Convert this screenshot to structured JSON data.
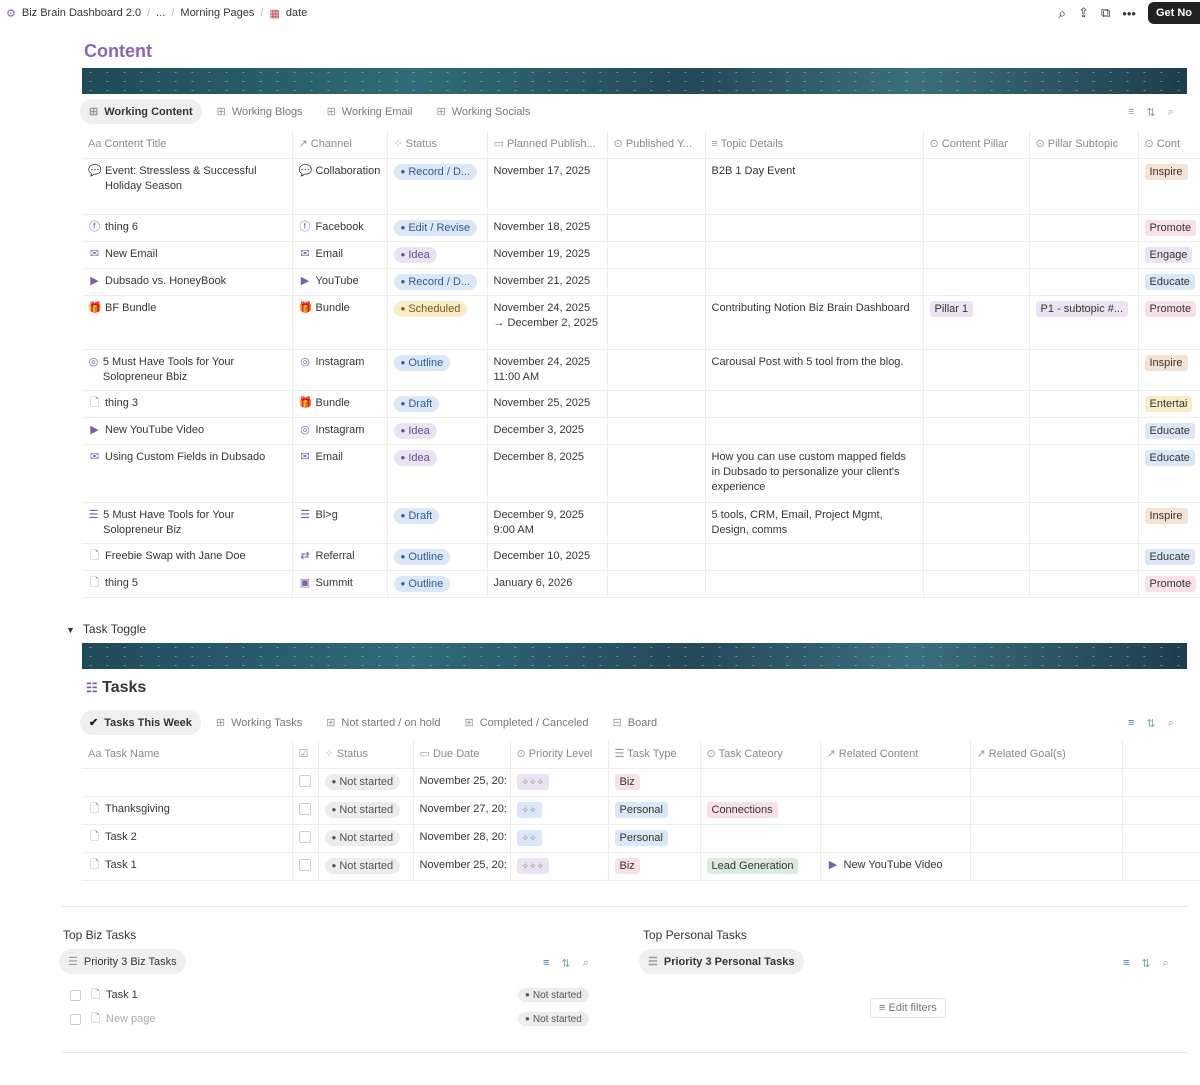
{
  "breadcrumb": {
    "workspace": "Biz Brain Dashboard 2.0",
    "ellipsis": "...",
    "parent": "Morning Pages",
    "page": "date"
  },
  "topbar": {
    "get_button": "Get No"
  },
  "content": {
    "title": "Content",
    "tabs": [
      "Working Content",
      "Working Blogs",
      "Working Email",
      "Working Socials"
    ],
    "columns": [
      "Content Title",
      "Channel",
      "Status",
      "Planned Publish...",
      "Published Y...",
      "Topic Details",
      "Content Pillar",
      "Pillar Subtopic",
      "Cont"
    ],
    "rows": [
      {
        "title": "Event: Stressless & Successful Holiday Season",
        "icon": "💬",
        "channel": "Collaboration",
        "channel_icon": "💬",
        "status": "Record / D...",
        "status_color": "blue",
        "planned": "November 17, 2025",
        "topic": "B2B 1 Day Event",
        "pillar": "",
        "subtopic": "",
        "cont": "Inspire",
        "cont_color": "orange"
      },
      {
        "title": "thing 6",
        "icon": "ⓕ",
        "channel": "Facebook",
        "channel_icon": "ⓕ",
        "status": "Edit / Revise",
        "status_color": "blue",
        "planned": "November 18, 2025",
        "topic": "",
        "pillar": "",
        "subtopic": "",
        "cont": "Promote",
        "cont_color": "red"
      },
      {
        "title": "New Email",
        "icon": "✉",
        "channel": "Email",
        "channel_icon": "✉",
        "status": "Idea",
        "status_color": "purple",
        "planned": "November 19, 2025",
        "topic": "",
        "pillar": "",
        "subtopic": "",
        "cont": "Engage",
        "cont_color": "purple"
      },
      {
        "title": "Dubsado vs. HoneyBook",
        "icon": "▶",
        "channel": "YouTube",
        "channel_icon": "▶",
        "status": "Record / D...",
        "status_color": "blue",
        "planned": "November 21, 2025",
        "topic": "",
        "pillar": "",
        "subtopic": "",
        "cont": "Educate",
        "cont_color": "blue"
      },
      {
        "title": "BF Bundle",
        "icon": "🎁",
        "channel": "Bundle",
        "channel_icon": "🎁",
        "status": "Scheduled",
        "status_color": "yellow",
        "planned": "November 24, 2025 → December 2, 2025",
        "topic": "Contributing Notion Biz Brain Dashboard",
        "pillar": "Pillar 1",
        "subtopic": "P1 - subtopic #...",
        "cont": "Promote",
        "cont_color": "red"
      },
      {
        "title": "5 Must Have Tools for Your Solopreneur Bbiz",
        "icon": "◎",
        "channel": "Instagram",
        "channel_icon": "◎",
        "status": "Outline",
        "status_color": "blue",
        "planned": "November 24, 2025 11:00 AM",
        "topic": "Carousal Post with 5 tool from the blog.",
        "pillar": "",
        "subtopic": "",
        "cont": "Inspire",
        "cont_color": "orange"
      },
      {
        "title": "thing 3",
        "icon": "doc",
        "channel": "Bundle",
        "channel_icon": "🎁",
        "status": "Draft",
        "status_color": "blue",
        "planned": "November 25, 2025",
        "topic": "",
        "pillar": "",
        "subtopic": "",
        "cont": "Entertai",
        "cont_color": "yellow"
      },
      {
        "title": "New YouTube Video",
        "icon": "▶",
        "channel": "Instagram",
        "channel_icon": "◎",
        "status": "Idea",
        "status_color": "purple",
        "planned": "December 3, 2025",
        "topic": "",
        "pillar": "",
        "subtopic": "",
        "cont": "Educate",
        "cont_color": "blue"
      },
      {
        "title": "Using Custom Fields in Dubsado",
        "icon": "✉",
        "channel": "Email",
        "channel_icon": "✉",
        "status": "Idea",
        "status_color": "purple",
        "planned": "December 8, 2025",
        "topic": "How you can use custom mapped fields in Dubsado to personalize your client's experience",
        "pillar": "",
        "subtopic": "",
        "cont": "Educate",
        "cont_color": "blue"
      },
      {
        "title": "5 Must Have Tools for Your Solopreneur Biz",
        "icon": "☰",
        "channel": "Bl>g",
        "channel_icon": "☰",
        "status": "Draft",
        "status_color": "blue",
        "planned": "December 9, 2025 9:00 AM",
        "topic": "5 tools, CRM, Email, Project Mgmt, Design, comms",
        "pillar": "",
        "subtopic": "",
        "cont": "Inspire",
        "cont_color": "orange"
      },
      {
        "title": "Freebie Swap with Jane Doe",
        "icon": "doc",
        "channel": "Referral",
        "channel_icon": "⇄",
        "status": "Outline",
        "status_color": "blue",
        "planned": "December 10, 2025",
        "topic": "",
        "pillar": "",
        "subtopic": "",
        "cont": "Educate",
        "cont_color": "blue"
      },
      {
        "title": "thing 5",
        "icon": "doc",
        "channel": "Summit",
        "channel_icon": "▣",
        "status": "Outline",
        "status_color": "blue",
        "planned": "January 6, 2026",
        "topic": "",
        "pillar": "",
        "subtopic": "",
        "cont": "Promote",
        "cont_color": "red"
      }
    ]
  },
  "toggle": {
    "label": "Task Toggle"
  },
  "tasks": {
    "title": "Tasks",
    "tabs": [
      "Tasks This Week",
      "Working Tasks",
      "Not started / on hold",
      "Completed / Canceled",
      "Board"
    ],
    "columns": [
      "Task Name",
      "",
      "Status",
      "Due Date",
      "Priority Level",
      "Task Type",
      "Task Cateory",
      "Related Content",
      "Related Goal(s)"
    ],
    "rows": [
      {
        "name": "",
        "status": "Not started",
        "due": "November 25, 20:",
        "priority": "✧✧✧",
        "priority_color": "purple",
        "type": "Biz",
        "type_color": "red",
        "category": "",
        "category_color": "",
        "related": ""
      },
      {
        "name": "Thanksgiving",
        "status": "Not started",
        "due": "November 27, 20:",
        "priority": "✧✧",
        "priority_color": "blue",
        "type": "Personal",
        "type_color": "blue",
        "category": "Connections",
        "category_color": "red",
        "related": ""
      },
      {
        "name": "Task 2",
        "status": "Not started",
        "due": "November 28, 20:",
        "priority": "✧✧",
        "priority_color": "blue",
        "type": "Personal",
        "type_color": "blue",
        "category": "",
        "category_color": "",
        "related": ""
      },
      {
        "name": "Task 1",
        "status": "Not started",
        "due": "November 25, 20:",
        "priority": "✧✧✧",
        "priority_color": "purple",
        "type": "Biz",
        "type_color": "red",
        "category": "Lead Generation",
        "category_color": "green",
        "related": "New YouTube Video"
      }
    ]
  },
  "biz": {
    "title": "Top Biz Tasks",
    "view": "Priority 3 Biz Tasks",
    "rows": [
      {
        "name": "Task 1",
        "status": "Not started"
      },
      {
        "name": "New page",
        "status": "Not started"
      }
    ]
  },
  "personal": {
    "title": "Top Personal Tasks",
    "view": "Priority 3 Personal Tasks",
    "edit_filters": "Edit filters"
  },
  "colors": {
    "blue": "#dbe7f6",
    "purple": "#ebe2f4",
    "red": "#f8e1e4",
    "orange": "#f5e2d3",
    "yellow": "#f7ecc6",
    "green": "#dcebdf",
    "gray": "#ececeb",
    "title": "#8a65b0"
  }
}
